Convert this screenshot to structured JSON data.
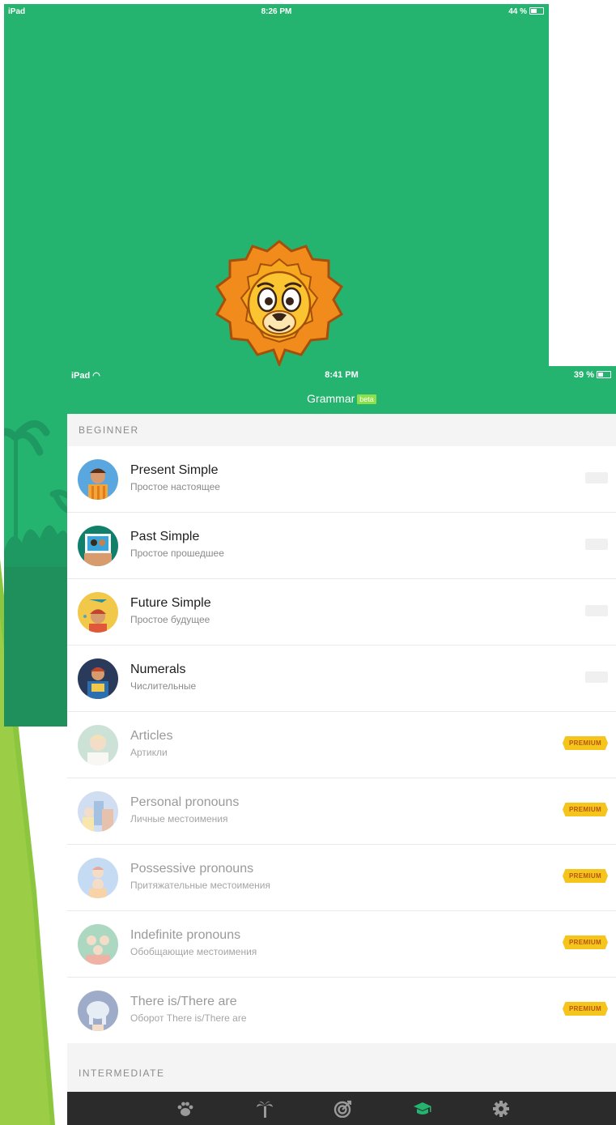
{
  "splash": {
    "status": {
      "device": "iPad",
      "time": "8:26 PM",
      "battery": "44 %"
    }
  },
  "app": {
    "status": {
      "device": "iPad",
      "time": "8:41 PM",
      "battery": "39 %"
    },
    "title": "Grammar",
    "badge": "beta",
    "sections": {
      "beginner": "BEGINNER",
      "intermediate": "INTERMEDIATE"
    },
    "lessons": [
      {
        "title": "Present Simple",
        "subtitle": "Простое настоящее",
        "premium": false
      },
      {
        "title": "Past Simple",
        "subtitle": "Простое прошедшее",
        "premium": false
      },
      {
        "title": "Future Simple",
        "subtitle": "Простое будущее",
        "premium": false
      },
      {
        "title": "Numerals",
        "subtitle": "Числительные",
        "premium": false
      },
      {
        "title": "Articles",
        "subtitle": "Артикли",
        "premium": true
      },
      {
        "title": "Personal pronouns",
        "subtitle": "Личные местоимения",
        "premium": true
      },
      {
        "title": "Possessive pronouns",
        "subtitle": "Притяжательные местоимения",
        "premium": true
      },
      {
        "title": "Indefinite pronouns",
        "subtitle": "Обобщающие местоимения",
        "premium": true
      },
      {
        "title": "There is/There are",
        "subtitle": "Оборот There is/There are",
        "premium": true
      }
    ],
    "premium_label": "PREMIUM",
    "tabs": [
      {
        "icon": "paw-icon",
        "active": false
      },
      {
        "icon": "palm-tree-icon",
        "active": false
      },
      {
        "icon": "target-icon",
        "active": false
      },
      {
        "icon": "graduation-cap-icon",
        "active": true
      },
      {
        "icon": "gear-icon",
        "active": false
      }
    ],
    "colors": {
      "brand": "#25b46f",
      "premium": "#f6c51d",
      "tabbar": "#2b2b2b",
      "tab_inactive": "#9a9a9a"
    }
  }
}
